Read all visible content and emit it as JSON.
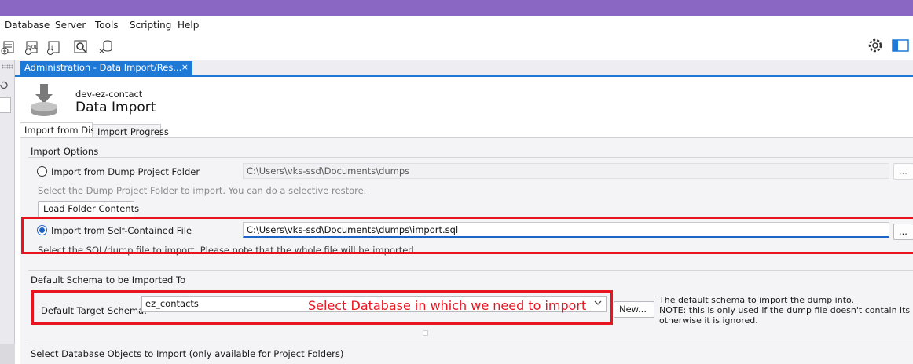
{
  "menu": [
    "Database",
    "Server",
    "Tools",
    "Scripting",
    "Help"
  ],
  "toolbar": {
    "icons": [
      "new-sql-tab-icon",
      "open-sql-script-icon",
      "open-inspector-icon",
      "search-table-data-icon",
      "reconnect-icon"
    ],
    "right_icons": [
      "settings-gear-icon",
      "toggle-sidebar-icon"
    ]
  },
  "document_tab": {
    "label": "Administration - Data Import/Res...",
    "close": "×"
  },
  "header": {
    "connection": "dev-ez-contact",
    "title": "Data Import"
  },
  "subtabs": [
    "Import from Disk",
    "Import Progress"
  ],
  "import_options": {
    "title": "Import Options",
    "dump_folder": {
      "label": "Import from Dump Project Folder",
      "path": "C:\\Users\\vks-ssd\\Documents\\dumps",
      "browse": "...",
      "hint": "Select the Dump Project Folder to import. You can do a selective restore.",
      "selected": false
    },
    "load_button": "Load Folder Contents",
    "self_contained": {
      "label": "Import from Self-Contained File",
      "path": "C:\\Users\\vks-ssd\\Documents\\dumps\\import.sql",
      "browse": "...",
      "hint": "Select the SQL/dump file to import. Please note that the whole file will be imported.",
      "selected": true
    }
  },
  "default_schema": {
    "title": "Default Schema to be Imported To",
    "label": "Default Target Schema:",
    "value": "ez_contacts",
    "new_button": "New...",
    "note_lines": [
      "The default schema to import the dump into.",
      "NOTE: this is only used if the dump file doesn't contain its schema,",
      "otherwise it is ignored."
    ]
  },
  "annotation": {
    "text": "Select Database in which we need to import",
    "color": "#e8141f"
  },
  "objects": {
    "title": "Select Database Objects to Import (only available for Project Folders)"
  },
  "colors": {
    "titlebar": "#8a67c2",
    "tab_active": "#1e78d6",
    "radio_selected": "#1e63c6",
    "highlight": "#e8141f"
  }
}
